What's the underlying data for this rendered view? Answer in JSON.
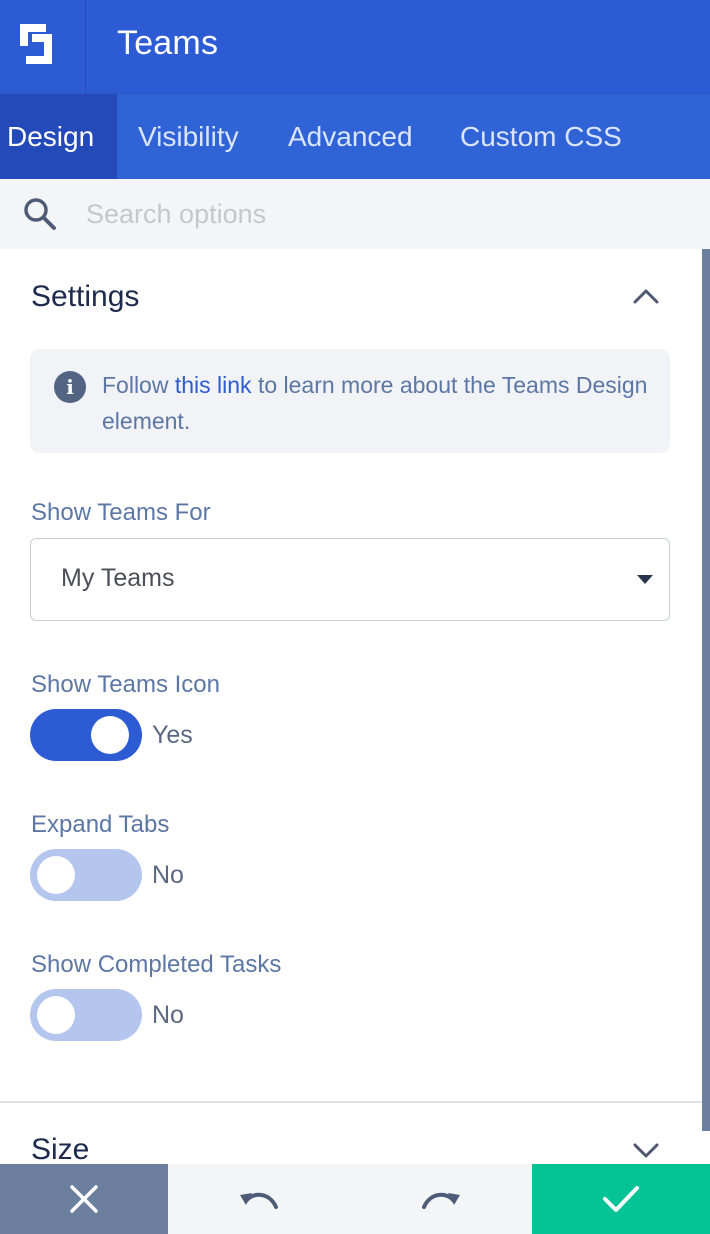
{
  "header": {
    "title": "Teams"
  },
  "tabs": [
    {
      "label": "Design",
      "active": true
    },
    {
      "label": "Visibility",
      "active": false
    },
    {
      "label": "Advanced",
      "active": false
    },
    {
      "label": "Custom CSS",
      "active": false
    }
  ],
  "search": {
    "placeholder": "Search options",
    "value": ""
  },
  "settings": {
    "title": "Settings",
    "info": {
      "before": "Follow ",
      "link": "this link",
      "after": " to learn more about the Teams Design element."
    },
    "show_teams_for": {
      "label": "Show Teams For",
      "value": "My Teams"
    },
    "show_teams_icon": {
      "label": "Show Teams Icon",
      "state": "Yes",
      "on": true
    },
    "expand_tabs": {
      "label": "Expand Tabs",
      "state": "No",
      "on": false
    },
    "show_completed_tasks": {
      "label": "Show Completed Tasks",
      "state": "No",
      "on": false
    }
  },
  "size": {
    "title": "Size"
  },
  "colors": {
    "brand": "#2d5bd3",
    "confirm": "#04c495",
    "cancel": "#6d7f9e",
    "toggle_off": "#b4c5ee"
  }
}
